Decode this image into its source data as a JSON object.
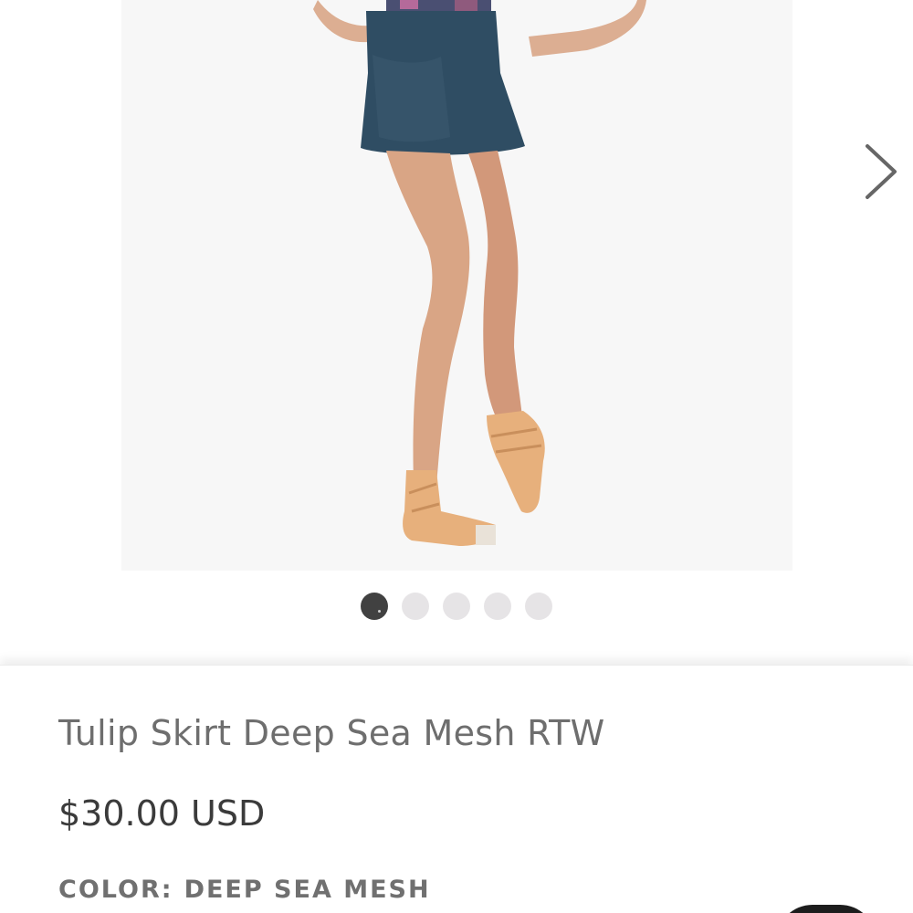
{
  "product": {
    "title": "Tulip Skirt Deep Sea Mesh RTW",
    "price": "$30.00 USD",
    "color_label": "COLOR:",
    "color_value": "DEEP SEA MESH"
  },
  "gallery": {
    "current_index": 1,
    "total_images": 5,
    "next_icon": "chevron-right-icon"
  },
  "colors": {
    "skirt": "#2f4d63",
    "shoe": "#e7b07c",
    "skin": "#d9a585",
    "dot_active": "#414141",
    "dot_inactive": "#e6e4e6"
  }
}
